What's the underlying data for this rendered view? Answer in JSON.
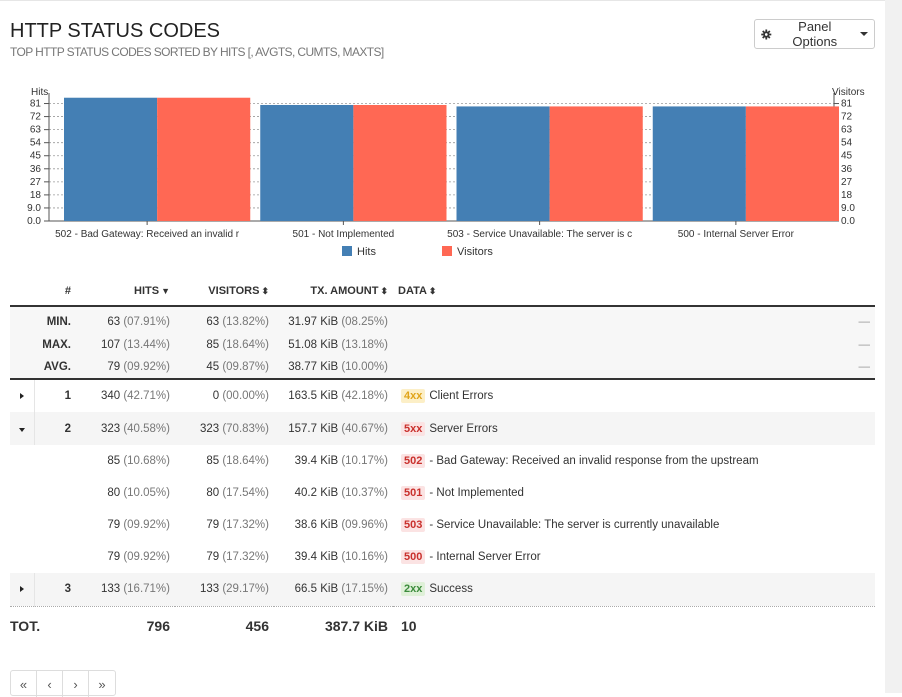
{
  "header": {
    "title": "HTTP STATUS CODES",
    "subtitle": "TOP HTTP STATUS CODES SORTED BY HITS [, AVGTS, CUMTS, MAXTS]",
    "panel_options": "Panel Options"
  },
  "chart_data": {
    "type": "bar",
    "categories": [
      "502 - Bad Gateway: Received an invalid r",
      "501 - Not Implemented",
      "503 - Service Unavailable: The server is c",
      "500 - Internal Server Error"
    ],
    "series": [
      {
        "name": "Hits",
        "values": [
          85,
          80,
          79,
          79
        ],
        "color": "#447fb4"
      },
      {
        "name": "Visitors",
        "values": [
          85,
          80,
          79,
          79
        ],
        "color": "#ff6854"
      }
    ],
    "ylabel_left": "Hits",
    "ylabel_right": "Visitors",
    "yticks": [
      "0.0",
      "9.0",
      "18",
      "27",
      "36",
      "45",
      "54",
      "63",
      "72",
      "81"
    ],
    "ylim": [
      0,
      85.5
    ],
    "grid": true,
    "legend": "bottom-center"
  },
  "table": {
    "headers": {
      "num": "#",
      "hits": "HITS",
      "visitors": "VISITORS",
      "tx": "TX. AMOUNT",
      "data": "DATA"
    },
    "summary": [
      {
        "label": "MIN.",
        "hits": "63",
        "hits_pct": "(07.91%)",
        "visitors": "63",
        "visitors_pct": "(13.82%)",
        "tx": "31.97 KiB",
        "tx_pct": "(08.25%)",
        "dash": "—"
      },
      {
        "label": "MAX.",
        "hits": "107",
        "hits_pct": "(13.44%)",
        "visitors": "85",
        "visitors_pct": "(18.64%)",
        "tx": "51.08 KiB",
        "tx_pct": "(13.18%)",
        "dash": "—"
      },
      {
        "label": "AVG.",
        "hits": "79",
        "hits_pct": "(09.92%)",
        "visitors": "45",
        "visitors_pct": "(09.87%)",
        "tx": "38.77 KiB",
        "tx_pct": "(10.00%)",
        "dash": "—"
      }
    ],
    "rows": [
      {
        "num": "1",
        "hits": "340",
        "hits_pct": "(42.71%)",
        "visitors": "0",
        "visitors_pct": "(00.00%)",
        "tx": "163.5 KiB",
        "tx_pct": "(42.18%)",
        "badge": "4xx",
        "text": "Client Errors"
      },
      {
        "num": "2",
        "hits": "323",
        "hits_pct": "(40.58%)",
        "visitors": "323",
        "visitors_pct": "(70.83%)",
        "tx": "157.7 KiB",
        "tx_pct": "(40.67%)",
        "badge": "5xx",
        "text": "Server Errors",
        "children": [
          {
            "hits": "85",
            "hits_pct": "(10.68%)",
            "visitors": "85",
            "visitors_pct": "(18.64%)",
            "tx": "39.4 KiB",
            "tx_pct": "(10.17%)",
            "badge": "502",
            "text": "- Bad Gateway: Received an invalid response from the upstream"
          },
          {
            "hits": "80",
            "hits_pct": "(10.05%)",
            "visitors": "80",
            "visitors_pct": "(17.54%)",
            "tx": "40.2 KiB",
            "tx_pct": "(10.37%)",
            "badge": "501",
            "text": "- Not Implemented"
          },
          {
            "hits": "79",
            "hits_pct": "(09.92%)",
            "visitors": "79",
            "visitors_pct": "(17.32%)",
            "tx": "38.6 KiB",
            "tx_pct": "(09.96%)",
            "badge": "503",
            "text": "- Service Unavailable: The server is currently unavailable"
          },
          {
            "hits": "79",
            "hits_pct": "(09.92%)",
            "visitors": "79",
            "visitors_pct": "(17.32%)",
            "tx": "39.4 KiB",
            "tx_pct": "(10.16%)",
            "badge": "500",
            "text": "- Internal Server Error"
          }
        ]
      },
      {
        "num": "3",
        "hits": "133",
        "hits_pct": "(16.71%)",
        "visitors": "133",
        "visitors_pct": "(29.17%)",
        "tx": "66.5 KiB",
        "tx_pct": "(17.15%)",
        "badge": "2xx",
        "text": "Success"
      }
    ],
    "total": {
      "label": "TOT.",
      "hits": "796",
      "visitors": "456",
      "tx": "387.7 KiB",
      "data": "10"
    }
  },
  "pagination": {
    "first": "«",
    "prev": "‹",
    "next": "›",
    "last": "»"
  }
}
